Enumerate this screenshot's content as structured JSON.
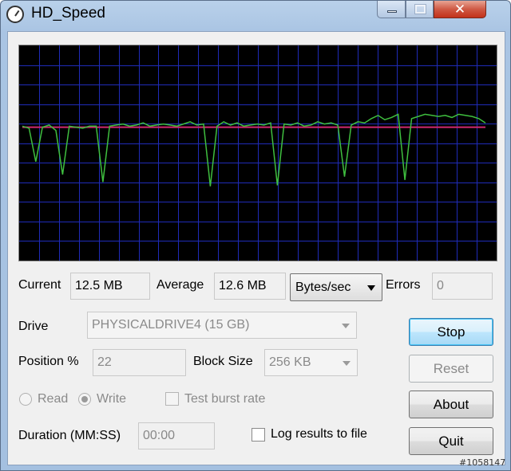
{
  "window": {
    "title": "HD_Speed",
    "close_glyph": "✕"
  },
  "icons": {
    "app": "stopwatch-icon",
    "minimize": "minimize-icon",
    "maximize": "maximize-icon",
    "close": "close-icon"
  },
  "colors": {
    "graph_bg": "#000000",
    "grid": "#1f2bb8",
    "average_line": "#d0286f",
    "speed_line": "#3fbf3f"
  },
  "readout": {
    "current_label": "Current",
    "current_value": "12.5 MB",
    "average_label": "Average",
    "average_value": "12.6 MB",
    "units_selected": "Bytes/sec",
    "errors_label": "Errors",
    "errors_value": "0"
  },
  "settings": {
    "drive_label": "Drive",
    "drive_value": "PHYSICALDRIVE4 (15 GB)",
    "position_label": "Position %",
    "position_value": "22",
    "block_size_label": "Block Size",
    "block_size_value": "256 KB",
    "read_label": "Read",
    "write_label": "Write",
    "burst_label": "Test burst rate",
    "duration_label": "Duration (MM:SS)",
    "duration_value": "00:00",
    "log_label": "Log results to file"
  },
  "buttons": {
    "stop": "Stop",
    "reset": "Reset",
    "about": "About",
    "quit": "Quit"
  },
  "watermark": "#1058147",
  "chart_data": {
    "type": "line",
    "ylim": [
      0,
      20
    ],
    "grid": true,
    "series": [
      {
        "role": "average",
        "values": [
          12.4,
          12.4,
          12.4,
          12.4,
          12.4,
          12.4,
          12.4,
          12.4,
          12.4,
          12.4,
          12.4,
          12.4,
          12.4,
          12.4,
          12.4,
          12.4,
          12.4,
          12.4,
          12.4,
          12.4,
          12.4,
          12.4,
          12.4,
          12.4,
          12.4,
          12.4,
          12.4,
          12.4,
          12.4,
          12.4,
          12.4,
          12.4,
          12.4,
          12.4,
          12.4,
          12.4,
          12.4,
          12.4,
          12.4,
          12.4,
          12.4,
          12.4,
          12.4,
          12.4,
          12.4,
          12.4,
          12.4,
          12.4,
          12.4,
          12.4,
          12.4,
          12.4,
          12.4,
          12.4,
          12.4,
          12.4,
          12.4,
          12.4,
          12.4,
          12.4
        ]
      },
      {
        "role": "current",
        "values": [
          12.5,
          12.3,
          9.2,
          12.4,
          12.6,
          12.1,
          8.0,
          12.5,
          12.4,
          12.3,
          12.5,
          12.5,
          7.3,
          12.5,
          12.6,
          12.7,
          12.5,
          12.6,
          12.8,
          12.5,
          12.6,
          12.7,
          12.6,
          12.5,
          12.7,
          12.9,
          12.6,
          12.7,
          6.9,
          12.5,
          12.9,
          12.6,
          12.8,
          12.5,
          12.6,
          12.7,
          12.6,
          12.8,
          7.0,
          12.7,
          12.6,
          12.8,
          12.5,
          12.6,
          12.9,
          12.7,
          12.8,
          12.6,
          7.8,
          12.6,
          12.9,
          12.8,
          13.2,
          13.5,
          13.1,
          13.3,
          13.6,
          7.5,
          13.2,
          13.4,
          13.6,
          13.5,
          13.4,
          13.5,
          13.3,
          13.6,
          13.5,
          13.4,
          13.2,
          12.8
        ]
      }
    ]
  }
}
